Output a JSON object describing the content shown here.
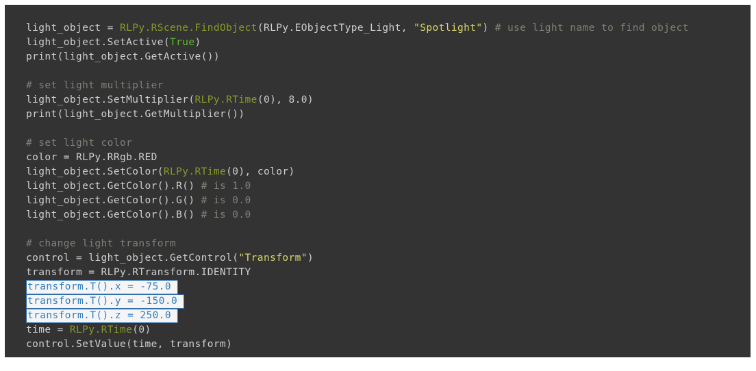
{
  "editor": {
    "background_color": "#333333",
    "default_text_color": "#cfcfcf",
    "api_color": "#8a9a27",
    "string_color": "#d9d66a",
    "keyword_color": "#5bbf2e",
    "comment_color": "#7d8275",
    "highlight_background": "#f5f5f5",
    "highlight_text_color": "#2f7fc4",
    "highlight_border_color": "#2f6fae",
    "language": "Python"
  },
  "code": {
    "lines": [
      {
        "index": 1,
        "highlighted": false,
        "text": "light_object = RLPy.RScene.FindObject(RLPy.EObjectType_Light, \"Spotlight\") # use light name to find object",
        "tokens": [
          {
            "t": "light_object = ",
            "c": "plain"
          },
          {
            "t": "RLPy.RScene.FindObject",
            "c": "api"
          },
          {
            "t": "(RLPy.EObjectType_Light, ",
            "c": "plain"
          },
          {
            "t": "\"Spotlight\"",
            "c": "string"
          },
          {
            "t": ") ",
            "c": "plain"
          },
          {
            "t": "# use light name to find object",
            "c": "comment"
          }
        ]
      },
      {
        "index": 2,
        "highlighted": false,
        "text": "light_object.SetActive(True)",
        "tokens": [
          {
            "t": "light_object.SetActive(",
            "c": "plain"
          },
          {
            "t": "True",
            "c": "keyword"
          },
          {
            "t": ")",
            "c": "plain"
          }
        ]
      },
      {
        "index": 3,
        "highlighted": false,
        "text": "print(light_object.GetActive())",
        "tokens": [
          {
            "t": "print(light_object.GetActive())",
            "c": "plain"
          }
        ]
      },
      {
        "index": 4,
        "highlighted": false,
        "text": "",
        "tokens": []
      },
      {
        "index": 5,
        "highlighted": false,
        "text": "# set light multiplier",
        "tokens": [
          {
            "t": "# set light multiplier",
            "c": "comment"
          }
        ]
      },
      {
        "index": 6,
        "highlighted": false,
        "text": "light_object.SetMultiplier(RLPy.RTime(0), 8.0)",
        "tokens": [
          {
            "t": "light_object.SetMultiplier(",
            "c": "plain"
          },
          {
            "t": "RLPy.RTime",
            "c": "api"
          },
          {
            "t": "(0), 8.0)",
            "c": "plain"
          }
        ]
      },
      {
        "index": 7,
        "highlighted": false,
        "text": "print(light_object.GetMultiplier())",
        "tokens": [
          {
            "t": "print(light_object.GetMultiplier())",
            "c": "plain"
          }
        ]
      },
      {
        "index": 8,
        "highlighted": false,
        "text": "",
        "tokens": []
      },
      {
        "index": 9,
        "highlighted": false,
        "text": "# set light color",
        "tokens": [
          {
            "t": "# set light color",
            "c": "comment"
          }
        ]
      },
      {
        "index": 10,
        "highlighted": false,
        "text": "color = RLPy.RRgb.RED",
        "tokens": [
          {
            "t": "color = RLPy.RRgb.RED",
            "c": "plain"
          }
        ]
      },
      {
        "index": 11,
        "highlighted": false,
        "text": "light_object.SetColor(RLPy.RTime(0), color)",
        "tokens": [
          {
            "t": "light_object.SetColor(",
            "c": "plain"
          },
          {
            "t": "RLPy.RTime",
            "c": "api"
          },
          {
            "t": "(0), color)",
            "c": "plain"
          }
        ]
      },
      {
        "index": 12,
        "highlighted": false,
        "text": "light_object.GetColor().R() # is 1.0",
        "tokens": [
          {
            "t": "light_object.GetColor().R() ",
            "c": "plain"
          },
          {
            "t": "# is 1.0",
            "c": "comment"
          }
        ]
      },
      {
        "index": 13,
        "highlighted": false,
        "text": "light_object.GetColor().G() # is 0.0",
        "tokens": [
          {
            "t": "light_object.GetColor().G() ",
            "c": "plain"
          },
          {
            "t": "# is 0.0",
            "c": "comment"
          }
        ]
      },
      {
        "index": 14,
        "highlighted": false,
        "text": "light_object.GetColor().B() # is 0.0",
        "tokens": [
          {
            "t": "light_object.GetColor().B() ",
            "c": "plain"
          },
          {
            "t": "# is 0.0",
            "c": "comment"
          }
        ]
      },
      {
        "index": 15,
        "highlighted": false,
        "text": "",
        "tokens": []
      },
      {
        "index": 16,
        "highlighted": false,
        "text": "# change light transform",
        "tokens": [
          {
            "t": "# change light transform",
            "c": "comment"
          }
        ]
      },
      {
        "index": 17,
        "highlighted": false,
        "text": "control = light_object.GetControl(\"Transform\")",
        "tokens": [
          {
            "t": "control = light_object.GetControl(",
            "c": "plain"
          },
          {
            "t": "\"Transform\"",
            "c": "string"
          },
          {
            "t": ")",
            "c": "plain"
          }
        ]
      },
      {
        "index": 18,
        "highlighted": false,
        "text": "transform = RLPy.RTransform.IDENTITY",
        "tokens": [
          {
            "t": "transform = RLPy.RTransform.IDENTITY",
            "c": "plain"
          }
        ]
      },
      {
        "index": 19,
        "highlighted": true,
        "width_class": "w1",
        "text": "transform.T().x = -75.0",
        "tokens": []
      },
      {
        "index": 20,
        "highlighted": true,
        "width_class": "w2",
        "text": "transform.T().y = -150.0",
        "tokens": []
      },
      {
        "index": 21,
        "highlighted": true,
        "width_class": "w3",
        "text": "transform.T().z = 250.0",
        "tokens": []
      },
      {
        "index": 22,
        "highlighted": false,
        "text": "time = RLPy.RTime(0)",
        "tokens": [
          {
            "t": "time = ",
            "c": "plain"
          },
          {
            "t": "RLPy.RTime",
            "c": "api"
          },
          {
            "t": "(0)",
            "c": "plain"
          }
        ]
      },
      {
        "index": 23,
        "highlighted": false,
        "text": "control.SetValue(time, transform)",
        "tokens": [
          {
            "t": "control.SetValue(time, transform)",
            "c": "plain"
          }
        ]
      }
    ]
  }
}
